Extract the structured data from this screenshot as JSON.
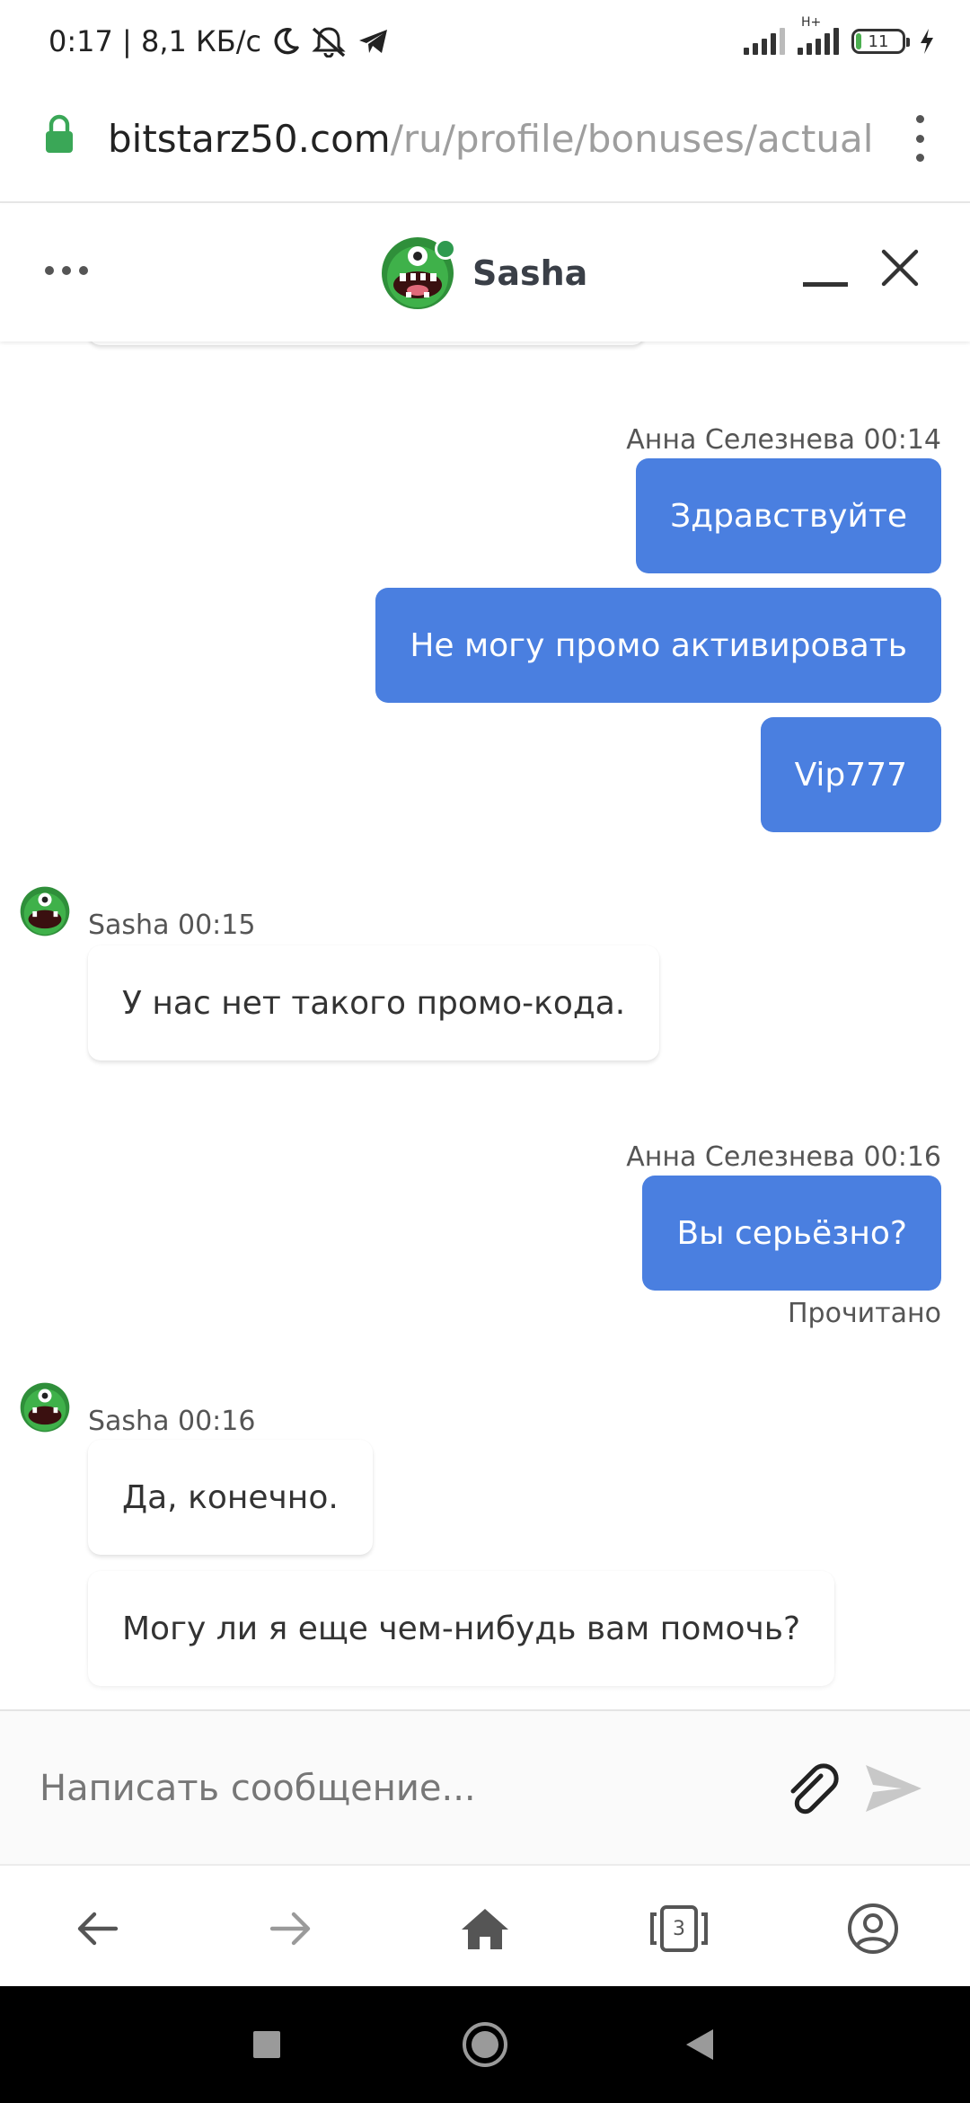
{
  "status_bar": {
    "time_speed": "0:17 | 8,1 КБ/с",
    "network_type": "H+",
    "battery_level": "11",
    "battery_fraction": 0.11
  },
  "browser": {
    "url_host": "bitstarz50.com",
    "url_path": "/ru/profile/bonuses/actual",
    "tab_count": "3"
  },
  "chat": {
    "agent_name": "Sasha",
    "input_placeholder": "Написать сообщение...",
    "colors": {
      "outgoing": "#4a7fe0",
      "online": "#2e9a4f"
    }
  },
  "messages": {
    "user_meta_1": "Анна Селезнева 00:14",
    "out_1": "Здравствуйте",
    "out_2": "Не могу промо активировать",
    "out_3": "Vip777",
    "agent_meta_1": "Sasha 00:15",
    "in_1": "У нас нет такого промо-кода.",
    "user_meta_2": "Анна Селезнева 00:16",
    "out_4": "Вы серьёзно?",
    "read_receipt": "Прочитано",
    "agent_meta_2": "Sasha 00:16",
    "in_2": "Да, конечно.",
    "in_3": "Могу ли я еще чем-нибудь вам помочь?"
  },
  "icons": {
    "status": [
      "moon-icon",
      "muted-bell-icon",
      "telegram-icon",
      "signal-icon",
      "battery-icon",
      "charging-icon"
    ],
    "browser": [
      "lock-icon",
      "kebab-menu-icon",
      "back-arrow-icon",
      "forward-arrow-icon",
      "home-icon",
      "tabs-icon",
      "account-icon"
    ],
    "chat": [
      "more-icon",
      "minimize-icon",
      "close-icon",
      "paperclip-icon",
      "send-icon"
    ]
  }
}
